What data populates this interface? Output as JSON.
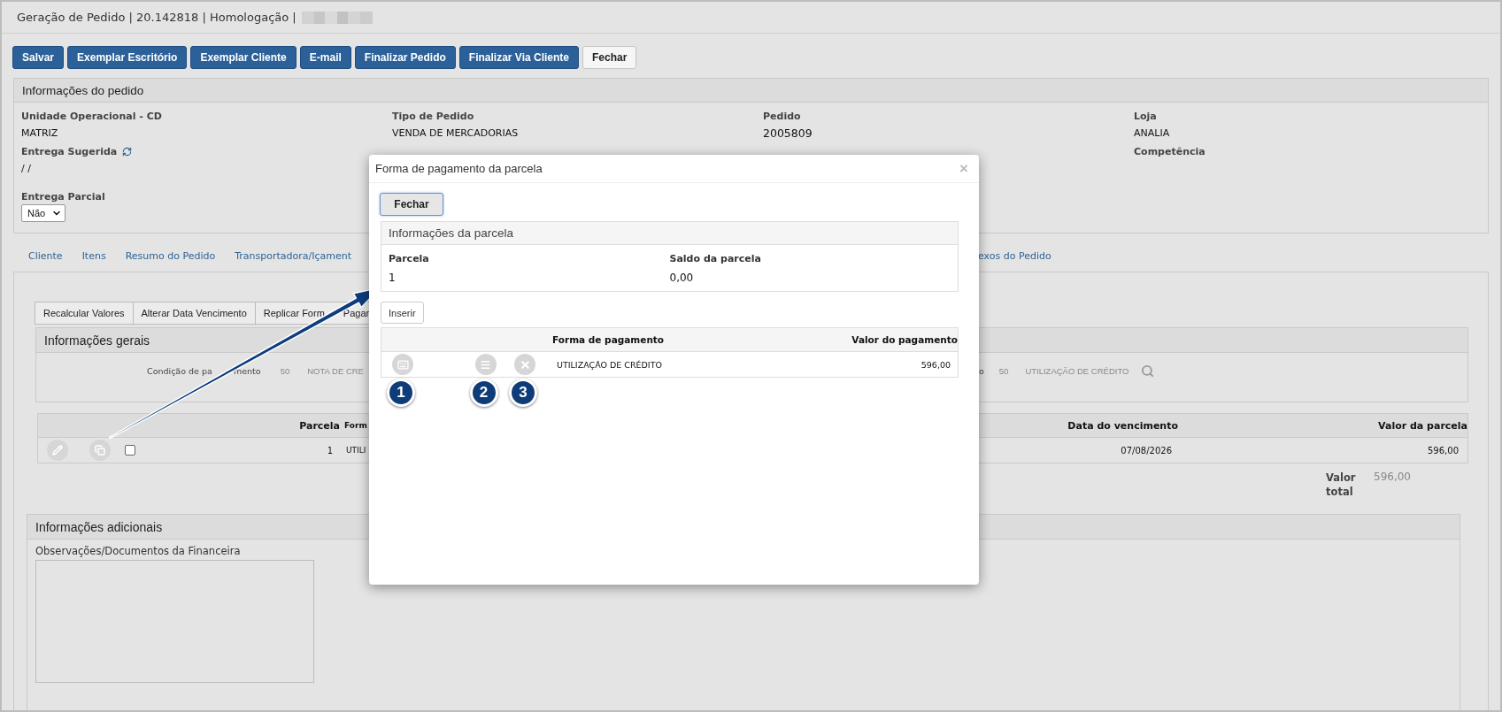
{
  "window": {
    "title": "Geração de Pedido | 20.142818 | Homologação |"
  },
  "toolbar": [
    {
      "label": "Salvar",
      "kind": "primary"
    },
    {
      "label": "Exemplar Escritório",
      "kind": "primary"
    },
    {
      "label": "Exemplar Cliente",
      "kind": "primary"
    },
    {
      "label": "E-mail",
      "kind": "primary"
    },
    {
      "label": "Finalizar Pedido",
      "kind": "primary"
    },
    {
      "label": "Finalizar Via Cliente",
      "kind": "primary"
    },
    {
      "label": "Fechar",
      "kind": "default"
    }
  ],
  "order_info": {
    "title": "Informações do pedido",
    "columns": [
      {
        "fields": [
          {
            "kind": "text",
            "label": "Unidade Operacional - CD",
            "value": "MATRIZ"
          },
          {
            "kind": "refresh",
            "label": "Entrega Sugerida",
            "value": "/ /"
          },
          {
            "kind": "select",
            "label": "Entrega Parcial",
            "value": "Não"
          }
        ]
      },
      {
        "fields": [
          {
            "kind": "text",
            "label": "Tipo de Pedido",
            "value": "VENDA DE MERCADORIAS"
          }
        ]
      },
      {
        "fields": [
          {
            "kind": "text",
            "label": "Pedido",
            "value": "2005809"
          }
        ]
      },
      {
        "fields": [
          {
            "kind": "text",
            "label": "Loja",
            "value": "ANALIA"
          },
          {
            "kind": "text",
            "label": "Competência"
          }
        ]
      }
    ]
  },
  "tabs_left": [
    {
      "label": "Cliente"
    },
    {
      "label": "Itens"
    },
    {
      "label": "Resumo do Pedido"
    },
    {
      "label": "Transportadora/Içament"
    }
  ],
  "tabs_right": [
    {
      "label": "exos do Pedido"
    }
  ],
  "actions": [
    {
      "label": "Recalcular Valores"
    },
    {
      "label": "Alterar Data Vencimento"
    },
    {
      "label": "Replicar Form",
      "label_end": "Pagar"
    }
  ],
  "general_info": {
    "title": "Informações gerais",
    "left": {
      "label": "Condição de pa",
      "label_end": "mento",
      "code": "50",
      "name": "NOTA DE CRE"
    },
    "right": {
      "label": "o",
      "code": "50",
      "name": "UTILIZAÇÃO DE CRÉDITO"
    }
  },
  "installments": {
    "columns": [
      "Parcela",
      "Form",
      "Data do vencimento",
      "Valor da parcela"
    ],
    "rows": [
      {
        "parcela": "1",
        "forma": "UTILI",
        "vencimento": "07/08/2026",
        "valor": "596,00",
        "checked": false
      }
    ]
  },
  "total": {
    "label": "Valor total",
    "value": "596,00"
  },
  "additional": {
    "title": "Informações adicionais",
    "notes_label": "Observações/Documentos da Financeira"
  },
  "modal": {
    "title": "Forma de pagamento da parcela",
    "close": "×",
    "close_button": "Fechar",
    "panel": {
      "title": "Informações da parcela",
      "fields": [
        {
          "label": "Parcela",
          "value": "1"
        },
        {
          "label": "Saldo da parcela",
          "value": "0,00"
        }
      ]
    },
    "insert_button": "Inserir",
    "table": {
      "columns": [
        "Forma de pagamento",
        "Valor do pagamento"
      ],
      "rows": [
        {
          "forma": "UTILIZAÇÃO DE CRÉDITO",
          "valor": "596,00"
        }
      ]
    },
    "markers": [
      "1",
      "2",
      "3"
    ]
  }
}
